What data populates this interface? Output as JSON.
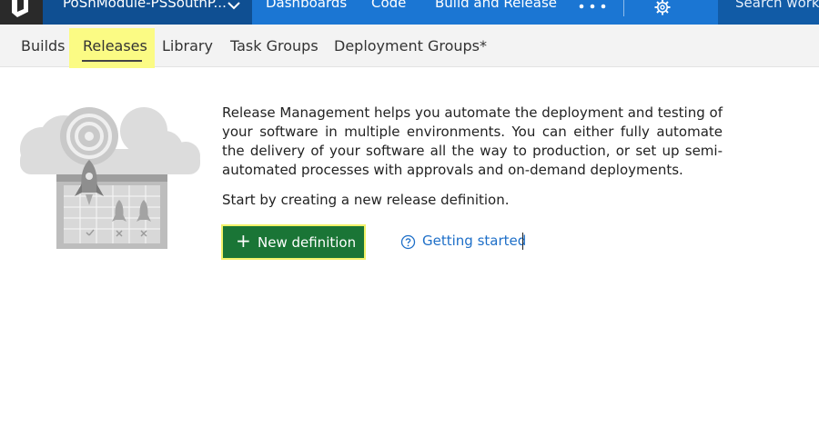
{
  "topbar": {
    "project_name": "PoShModule-PSSouthP...",
    "nav": [
      "Dashboards",
      "Code",
      "Build and Release"
    ],
    "search_placeholder": "Search work"
  },
  "subnav": {
    "tabs": [
      "Builds",
      "Releases",
      "Library",
      "Task Groups",
      "Deployment Groups*"
    ],
    "active_tab": "Releases"
  },
  "content": {
    "description": "Release Management helps you automate the deployment and testing of your software in multiple environments. You can either fully automate the delivery of your software all the way to production, or set up semi-automated processes with approvals and on-demand deployments.",
    "start_text": "Start by creating a new release definition.",
    "new_definition_label": "New definition",
    "getting_started_label": "Getting started"
  },
  "colors": {
    "topbar": "#1b76d3",
    "project_box": "#0f4f92",
    "new_button": "#1a7536",
    "highlight": "#fbfb84",
    "link": "#1e6fc8"
  },
  "icons": [
    "vsts-logo-icon",
    "chevron-down-icon",
    "more-icon",
    "gear-icon",
    "plus-icon",
    "help-circle-icon"
  ]
}
